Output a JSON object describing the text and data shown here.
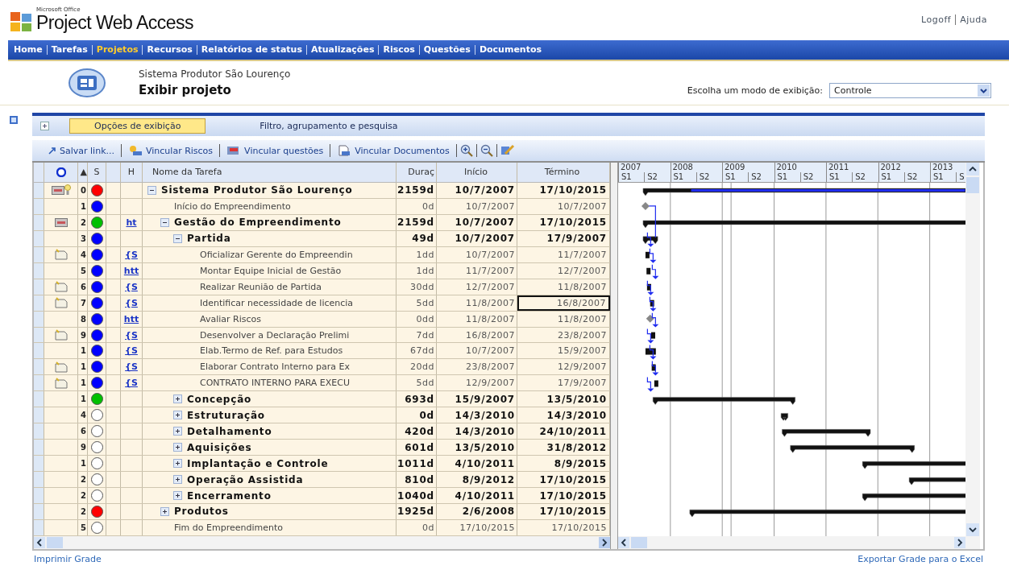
{
  "header": {
    "brand_small": "Microsoft Office",
    "brand": "Project Web Access",
    "links": [
      "Logoff",
      "Ajuda"
    ]
  },
  "nav": [
    {
      "label": "Home",
      "selected": false
    },
    {
      "label": "Tarefas",
      "selected": false
    },
    {
      "label": "Projetos",
      "selected": true
    },
    {
      "label": "Recursos",
      "selected": false
    },
    {
      "label": "Relatórios de status",
      "selected": false
    },
    {
      "label": "Atualizações",
      "selected": false
    },
    {
      "label": "Riscos",
      "selected": false
    },
    {
      "label": "Questões",
      "selected": false
    },
    {
      "label": "Documentos",
      "selected": false
    }
  ],
  "project": {
    "name": "Sistema Produtor São Lourenço",
    "title": "Exibir projeto",
    "view_label": "Escolha um modo de exibição:",
    "view_value": "Controle"
  },
  "option_tabs": [
    {
      "label": "Opções de exibição",
      "selected": true
    },
    {
      "label": "Filtro, agrupamento e pesquisa",
      "selected": false
    }
  ],
  "toolbar": [
    {
      "label": "Salvar link...",
      "kind": "save"
    },
    {
      "label": "Vincular Riscos",
      "kind": "risks"
    },
    {
      "label": "Vincular questões",
      "kind": "issues"
    },
    {
      "label": "Vincular Documentos",
      "kind": "documents"
    },
    {
      "kind": "zoom-in"
    },
    {
      "kind": "zoom-out"
    },
    {
      "kind": "edit"
    }
  ],
  "grid": {
    "columns": [
      "▲",
      "S",
      "H",
      "Nome da Tarefa",
      "Duraç",
      "Início",
      "Término"
    ],
    "rows": [
      {
        "id": "0",
        "indicators": [
          {
            "kind": "card"
          },
          {
            "kind": "bulb"
          }
        ],
        "color": "#ff0000",
        "name": "Sistema Produtor São Lourenço",
        "duration": "2159d",
        "start": "10/7/2007",
        "end": "17/10/2015",
        "kind": "summary",
        "expanded": true,
        "selected": false,
        "children": [
          {
            "id": "1",
            "color": "#0000ff",
            "name": "Início do Empreendimento",
            "duration": "0d",
            "start": "10/7/2007",
            "end": "10/7/2007",
            "kind": "task",
            "selected": false
          },
          {
            "id": "2",
            "indicators": [
              {
                "kind": "card"
              }
            ],
            "color": "#00c000",
            "link": "ht",
            "name": "Gestão do Empreendimento",
            "duration": "2159d",
            "start": "10/7/2007",
            "end": "17/10/2015",
            "kind": "summary",
            "expanded": true,
            "selected": false,
            "children": [
              {
                "id": "3",
                "color": "#0000ff",
                "name": "Partida",
                "duration": "49d",
                "start": "10/7/2007",
                "end": "17/9/2007",
                "kind": "summary",
                "expanded": true,
                "selected": false,
                "children": [
                  {
                    "id": "4",
                    "indicators": [
                      {
                        "kind": "note"
                      }
                    ],
                    "color": "#0000ff",
                    "link": "{S",
                    "name": "Oficializar Gerente do Empreendin",
                    "duration": "1dd",
                    "start": "10/7/2007",
                    "end": "11/7/2007",
                    "kind": "task",
                    "selected": false
                  },
                  {
                    "id": "5",
                    "color": "#0000ff",
                    "link": "htt",
                    "name": "Montar Equipe Inicial de Gestão",
                    "duration": "1dd",
                    "start": "11/7/2007",
                    "end": "12/7/2007",
                    "kind": "task",
                    "selected": false
                  },
                  {
                    "id": "6",
                    "indicators": [
                      {
                        "kind": "note"
                      }
                    ],
                    "color": "#0000ff",
                    "link": "{S",
                    "name": "Realizar Reunião de Partida",
                    "duration": "30dd",
                    "start": "12/7/2007",
                    "end": "11/8/2007",
                    "kind": "task",
                    "selected": false
                  },
                  {
                    "id": "7",
                    "indicators": [
                      {
                        "kind": "note"
                      }
                    ],
                    "color": "#0000ff",
                    "link": "{S",
                    "name": "Identificar necessidade de licencia",
                    "duration": "5dd",
                    "start": "11/8/2007",
                    "end": "16/8/2007",
                    "kind": "task",
                    "selected": true
                  },
                  {
                    "id": "8",
                    "color": "#0000ff",
                    "link": "htt",
                    "name": "Avaliar Riscos",
                    "duration": "0dd",
                    "start": "11/8/2007",
                    "end": "11/8/2007",
                    "kind": "task",
                    "selected": false
                  },
                  {
                    "id": "9",
                    "indicators": [
                      {
                        "kind": "note"
                      }
                    ],
                    "color": "#0000ff",
                    "link": "{S",
                    "name": "Desenvolver a Declaração Prelimi",
                    "duration": "7dd",
                    "start": "16/8/2007",
                    "end": "23/8/2007",
                    "kind": "task",
                    "selected": false
                  },
                  {
                    "id": "1",
                    "color": "#0000ff",
                    "link": "{S",
                    "name": "Elab.Termo de Ref. para Estudos",
                    "duration": "67dd",
                    "start": "10/7/2007",
                    "end": "15/9/2007",
                    "kind": "task",
                    "selected": false
                  },
                  {
                    "id": "1",
                    "indicators": [
                      {
                        "kind": "note"
                      }
                    ],
                    "color": "#0000ff",
                    "link": "{S",
                    "name": "Elaborar Contrato Interno para Ex",
                    "duration": "20dd",
                    "start": "23/8/2007",
                    "end": "12/9/2007",
                    "kind": "task",
                    "selected": false
                  },
                  {
                    "id": "1",
                    "indicators": [
                      {
                        "kind": "note"
                      }
                    ],
                    "color": "#0000ff",
                    "link": "{S",
                    "name": "CONTRATO INTERNO PARA EXECU",
                    "duration": "5dd",
                    "start": "12/9/2007",
                    "end": "17/9/2007",
                    "kind": "task",
                    "selected": false
                  }
                ]
              },
              {
                "id": "1",
                "color": "#00c000",
                "name": "Concepção",
                "duration": "693d",
                "start": "15/9/2007",
                "end": "13/5/2010",
                "kind": "summary",
                "expanded": false,
                "selected": false
              },
              {
                "id": "4",
                "color": "#ffffff",
                "name": "Estruturação",
                "duration": "0d",
                "start": "14/3/2010",
                "end": "14/3/2010",
                "kind": "summary",
                "expanded": false,
                "selected": false
              },
              {
                "id": "6",
                "color": "#ffffff",
                "name": "Detalhamento",
                "duration": "420d",
                "start": "14/3/2010",
                "end": "24/10/2011",
                "kind": "summary",
                "expanded": false,
                "selected": false
              },
              {
                "id": "9",
                "color": "#ffffff",
                "name": "Aquisições",
                "duration": "601d",
                "start": "13/5/2010",
                "end": "31/8/2012",
                "kind": "summary",
                "expanded": false,
                "selected": false
              },
              {
                "id": "1",
                "color": "#ffffff",
                "name": "Implantação e Controle",
                "duration": "1011d",
                "start": "4/10/2011",
                "end": "8/9/2015",
                "kind": "summary",
                "expanded": false,
                "selected": false
              },
              {
                "id": "2",
                "color": "#ffffff",
                "name": "Operação Assistida",
                "duration": "810d",
                "start": "8/9/2012",
                "end": "17/10/2015",
                "kind": "summary",
                "expanded": false,
                "selected": false
              },
              {
                "id": "2",
                "color": "#ffffff",
                "name": "Encerramento",
                "duration": "1040d",
                "start": "4/10/2011",
                "end": "17/10/2015",
                "kind": "summary",
                "expanded": false,
                "selected": false
              }
            ]
          },
          {
            "id": "2",
            "color": "#ff0000",
            "name": "Produtos",
            "duration": "1925d",
            "start": "2/6/2008",
            "end": "17/10/2015",
            "kind": "summary",
            "expanded": false,
            "selected": false
          },
          {
            "id": "5",
            "color": "#ffffff",
            "name": "Fim do Empreendimento",
            "duration": "0d",
            "start": "17/10/2015",
            "end": "17/10/2015",
            "kind": "task",
            "selected": false
          }
        ]
      }
    ]
  },
  "timeline": {
    "years": [
      "2007",
      "2008",
      "2009",
      "2010",
      "2011",
      "2012",
      "2013"
    ],
    "halves": [
      "S1",
      "S2",
      "S1",
      "S2",
      "S1",
      "S2",
      "S1",
      "S2",
      "S1",
      "S2",
      "S1",
      "S2",
      "S1",
      "S"
    ]
  },
  "footer": {
    "left": "Imprimir Grade",
    "right": "Exportar Grade para o Excel"
  }
}
